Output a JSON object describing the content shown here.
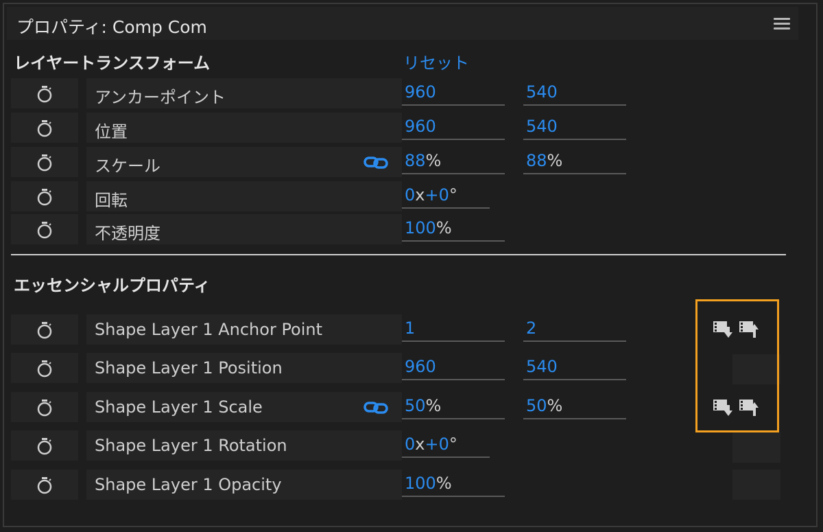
{
  "panel": {
    "title": "プロパティ: Comp Com",
    "menu_icon": "hamburger-menu-icon"
  },
  "layer_transform": {
    "title": "レイヤートランスフォーム",
    "reset_label": "リセット",
    "rows": [
      {
        "label": "アンカーポイント",
        "v1": "960",
        "u1": "",
        "v2": "540",
        "u2": ""
      },
      {
        "label": "位置",
        "v1": "960",
        "u1": "",
        "v2": "540",
        "u2": ""
      },
      {
        "label": "スケール",
        "v1": "88",
        "u1": "%",
        "v2": "88",
        "u2": "%",
        "linked": true
      },
      {
        "label": "回転",
        "v1": "0",
        "u1": "x",
        "v1b": "+0",
        "u1b": "°"
      },
      {
        "label": "不透明度",
        "v1": "100",
        "u1": "%"
      }
    ]
  },
  "essential_properties": {
    "title": "エッセンシャルプロパティ",
    "rows": [
      {
        "label": "Shape Layer 1 Anchor Point",
        "v1": "1",
        "u1": "",
        "v2": "2",
        "u2": ""
      },
      {
        "label": "Shape Layer 1 Position",
        "v1": "960",
        "u1": "",
        "v2": "540",
        "u2": ""
      },
      {
        "label": "Shape Layer 1 Scale",
        "v1": "50",
        "u1": "%",
        "v2": "50",
        "u2": "%",
        "linked": true
      },
      {
        "label": "Shape Layer 1 Rotation",
        "v1": "0",
        "u1": "x",
        "v1b": "+0",
        "u1b": "°"
      },
      {
        "label": "Shape Layer 1 Opacity",
        "v1": "100",
        "u1": "%"
      }
    ],
    "icons": [
      "push-to-layer-icon",
      "pull-from-layer-icon"
    ]
  },
  "colors": {
    "accent_blue": "#2b8cf0",
    "highlight_orange": "#f4a020",
    "background": "#1e1e1e"
  }
}
